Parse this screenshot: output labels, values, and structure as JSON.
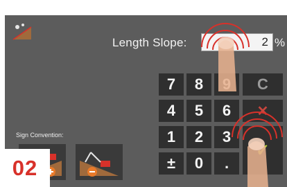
{
  "length_slope": {
    "label": "Length Slope:",
    "value": "2",
    "unit": "%"
  },
  "keypad": {
    "rows": [
      [
        "7",
        "8",
        "9",
        "C"
      ],
      [
        "4",
        "5",
        "6",
        "✕"
      ],
      [
        "1",
        "2",
        "3",
        "✓"
      ],
      [
        "±",
        "0",
        ".",
        ""
      ]
    ]
  },
  "sign_convention": {
    "label": "Sign Convention:"
  },
  "step_badge": "02",
  "icons": {
    "app": "slope-icon",
    "backspace": "x-icon",
    "confirm": "check-icon",
    "sign_positive": "excavator-positive-slope-icon",
    "sign_negative": "excavator-negative-slope-icon"
  },
  "colors": {
    "accent": "#d8312a",
    "confirm": "#b7cf3a",
    "panel": "#5c5c5c"
  }
}
